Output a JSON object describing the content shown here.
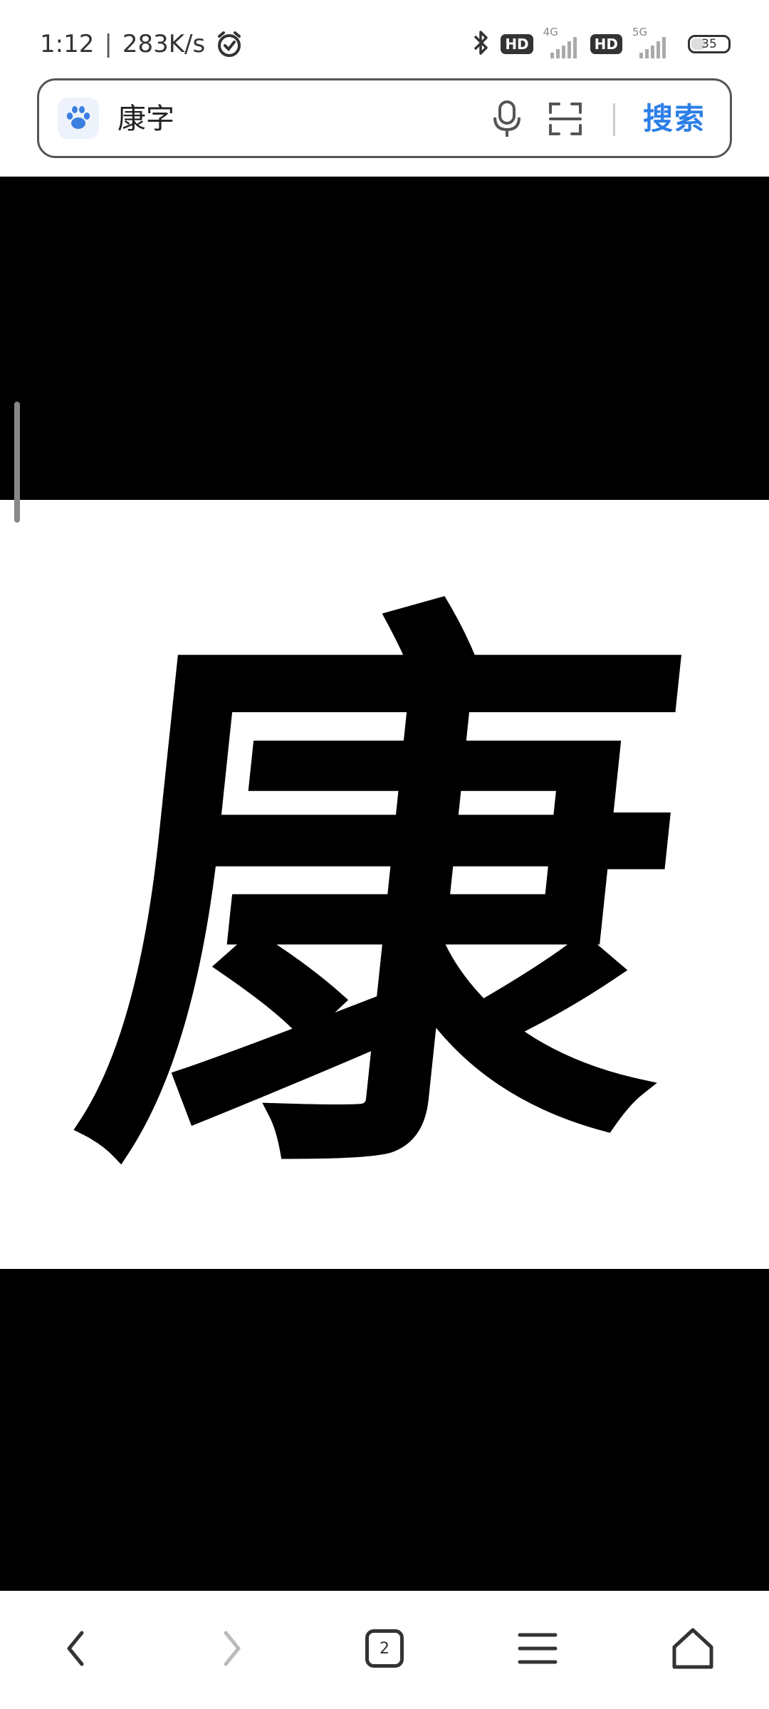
{
  "status_bar": {
    "time": "1:12",
    "separator": "|",
    "network_speed": "283K/s",
    "sim1_network": "4G",
    "sim1_badge": "HD",
    "sim2_network": "5G",
    "sim2_badge": "HD",
    "battery_level": "35"
  },
  "search": {
    "query": "康字",
    "submit_label": "搜索"
  },
  "image": {
    "character": "康"
  },
  "bottom_nav": {
    "tab_count": "2"
  },
  "colors": {
    "accent": "#2d7fe8",
    "paw_icon": "#3b7fe0"
  },
  "icons": {
    "alarm": "alarm-clock-icon",
    "bluetooth": "bluetooth-icon",
    "signal": "signal-icon",
    "battery": "battery-icon",
    "paw": "baidu-paw-icon",
    "mic": "microphone-icon",
    "scan": "scan-icon",
    "back": "chevron-left-icon",
    "forward": "chevron-right-icon",
    "tabs": "tabs-icon",
    "menu": "hamburger-menu-icon",
    "home": "home-icon"
  }
}
